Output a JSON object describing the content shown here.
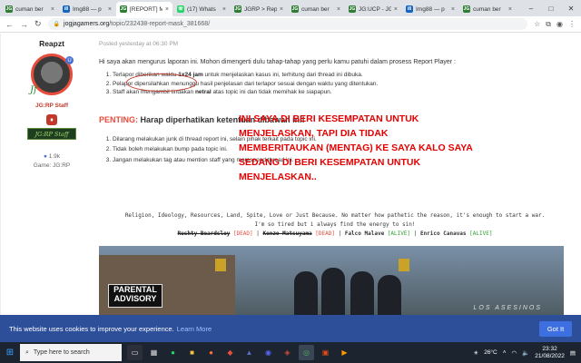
{
  "browser": {
    "tabs": [
      {
        "title": "cuman ber",
        "color": "#2e7d32",
        "glyph": "JG",
        "active": false
      },
      {
        "title": "Img88 — p",
        "color": "#1565c0",
        "glyph": "i8",
        "active": false
      },
      {
        "title": "[REPORT] M",
        "color": "#2e7d32",
        "glyph": "JG",
        "active": true
      },
      {
        "title": "(17) Whats",
        "color": "#25d366",
        "glyph": "☏",
        "active": false
      },
      {
        "title": "JGRP > Rep",
        "color": "#2e7d32",
        "glyph": "JG",
        "active": false
      },
      {
        "title": "cuman ber",
        "color": "#2e7d32",
        "glyph": "JG",
        "active": false
      },
      {
        "title": "JG:UCP - JG",
        "color": "#2e7d32",
        "glyph": "JG",
        "active": false
      },
      {
        "title": "Img88 — p",
        "color": "#1565c0",
        "glyph": "i8",
        "active": false
      },
      {
        "title": "cuman ber",
        "color": "#2e7d32",
        "glyph": "JG",
        "active": false
      }
    ],
    "url_domain": "jogjagamers.org",
    "url_path": "/topic/232438-report-mask_381668/"
  },
  "user": {
    "name": "Reapzt",
    "group": "JG:RP Staff",
    "staff_banner": "JG:RP Staff",
    "likes": "1.9k",
    "game": "Game: JG:RP"
  },
  "post": {
    "posted": "Posted yesterday at 06:30 PM",
    "intro": "Hi saya akan mengurus laporan ini. Mohon dimengerti dulu tahap-tahap yang perlu kamu patuhi dalam prosess Report Player :",
    "rules": [
      {
        "pre": "Terlapor diberikan waktu ",
        "bold": "1x24 jam",
        "post": " untuk menjelaskan kasus ini, terhitung dari thread ini dibuka."
      },
      {
        "pre": "Pelapor dipersilahkan menunggu hasil penjelasan dari terlapor sesuai dengan waktu yang ditentukan.",
        "bold": "",
        "post": ""
      },
      {
        "pre": "Staff akan mengambil tindakan ",
        "bold": "netral",
        "post": " atas topic ini dan tidak memihak ke siapapun."
      }
    ],
    "penting_label": "PENTING:",
    "penting_text": "Harap diperhatikan ketentuan dibawah ini!",
    "rules2": [
      "Dilarang melakukan junk di thread report ini, selain pihak terkait pada topic ini.",
      "Tidak boleh melakukan bump pada topic ini.",
      "Jangan melakukan tag atau mention staff yang merespond thread ini."
    ],
    "red_note": "INI SAYA DI BERI KESEMPATAN UNTUK MENJELASKAN, TAPI DIA TIDAK MEMBERITAUKAN (MENTAG) KE SAYA KALO SAYA SEDANG DI BERI KESEMPATAN UNTUK MENJELASKAN.."
  },
  "signature": {
    "quote1": "Religion, Ideology, Resources, Land, Spite, Love or Just Because. No matter how pathetic the reason, it's enough to start a war.",
    "quote2": "I'm so tired but i always find the energy to sin!",
    "members": [
      {
        "name": "Rushty Beardsley",
        "status": "DEAD",
        "struck": true
      },
      {
        "name": "Kenzo Matsuyama",
        "status": "DEAD",
        "struck": true
      },
      {
        "name": "Falco Malave",
        "status": "ALIVE",
        "struck": false
      },
      {
        "name": "Enrico Canavas",
        "status": "ALIVE",
        "struck": false
      }
    ],
    "banner_advisory": "PARENTAL ADVISORY",
    "banner_caption": "LOS ASESINOS"
  },
  "cookie": {
    "text": "This website uses cookies to improve your experience.",
    "learn_more": "Learn More",
    "button": "Got It"
  },
  "taskbar": {
    "search_placeholder": "Type here to search",
    "weather": "26°C",
    "time": "23:32",
    "date": "21/08/2022"
  }
}
